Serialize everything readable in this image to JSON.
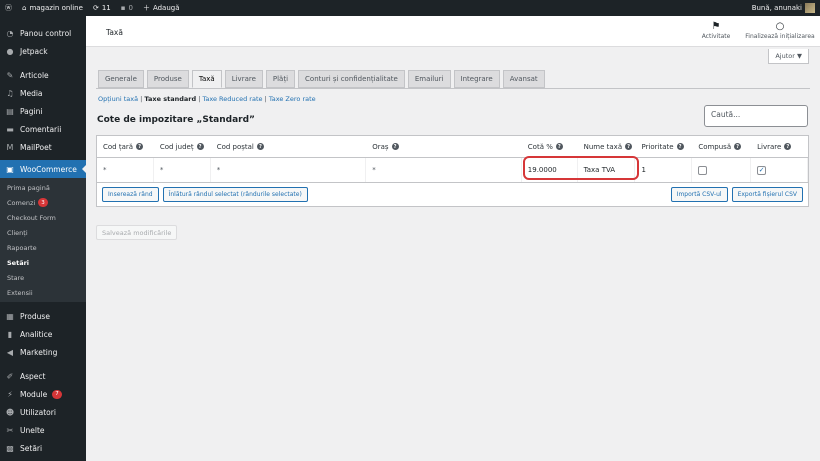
{
  "adminbar": {
    "site_name": "magazin online",
    "updates": "11",
    "comments": "0",
    "add_new": "Adaugă",
    "user_greeting": "Bună, anunaki"
  },
  "sidebar": {
    "top_items": [
      {
        "label": "Panou control",
        "icon": "dashboard-icon"
      },
      {
        "label": "Jetpack",
        "icon": "jetpack-icon"
      },
      {
        "label": "Articole",
        "icon": "pin-icon"
      },
      {
        "label": "Media",
        "icon": "media-icon"
      },
      {
        "label": "Pagini",
        "icon": "page-icon"
      },
      {
        "label": "Comentarii",
        "icon": "comment-icon"
      },
      {
        "label": "MailPoet",
        "icon": "mailpoet-icon"
      },
      {
        "label": "WooCommerce",
        "icon": "woo-icon"
      }
    ],
    "woo_submenu": [
      {
        "label": "Prima pagină",
        "badge": ""
      },
      {
        "label": "Comenzi",
        "badge": "3"
      },
      {
        "label": "Checkout Form",
        "badge": ""
      },
      {
        "label": "Clienți",
        "badge": ""
      },
      {
        "label": "Rapoarte",
        "badge": ""
      },
      {
        "label": "Setări",
        "badge": ""
      },
      {
        "label": "Stare",
        "badge": ""
      },
      {
        "label": "Extensii",
        "badge": ""
      }
    ],
    "bottom_items": [
      {
        "label": "Produse",
        "icon": "products-icon",
        "badge": ""
      },
      {
        "label": "Analitice",
        "icon": "analytics-icon",
        "badge": ""
      },
      {
        "label": "Marketing",
        "icon": "megaphone-icon",
        "badge": ""
      },
      {
        "label": "Aspect",
        "icon": "brush-icon",
        "badge": ""
      },
      {
        "label": "Module",
        "icon": "plugin-icon",
        "badge": "7"
      },
      {
        "label": "Utilizatori",
        "icon": "users-icon",
        "badge": ""
      },
      {
        "label": "Unelte",
        "icon": "tools-icon",
        "badge": ""
      },
      {
        "label": "Setări",
        "icon": "settings-icon",
        "badge": ""
      }
    ]
  },
  "header": {
    "title": "Taxă",
    "activity": "Activitate",
    "finish_setup": "Finalizează inițializarea",
    "help": "Ajutor ▼"
  },
  "tabs": [
    "Generale",
    "Produse",
    "Taxă",
    "Livrare",
    "Plăți",
    "Conturi și confidențialitate",
    "Emailuri",
    "Integrare",
    "Avansat"
  ],
  "subsub": {
    "options": "Opțiuni taxă",
    "sep1": " | ",
    "standard": "Taxe standard",
    "sep2": " | ",
    "reduced": "Taxe Reduced rate",
    "sep3": " | ",
    "zero": "Taxe Zero rate"
  },
  "section_title": "Cote de impozitare „Standard”",
  "search_placeholder": "Caută...",
  "table": {
    "headers": [
      "Cod țară",
      "Cod județ",
      "Cod poștal",
      "Oraș",
      "Cotă %",
      "Nume taxă",
      "Prioritate",
      "Compusă",
      "Livrare"
    ],
    "row": {
      "country": "*",
      "state": "*",
      "postcode": "*",
      "city": "*",
      "rate": "19.0000",
      "name": "Taxa TVA",
      "priority": "1",
      "compound": false,
      "shipping": true
    },
    "insert_row": "Inserează rând",
    "remove_row": "Înlătură rândul selectat (rândurile selectate)",
    "import_csv": "Importă CSV-ul",
    "export_csv": "Exportă fișierul CSV"
  },
  "save_button": "Salvează modificările"
}
